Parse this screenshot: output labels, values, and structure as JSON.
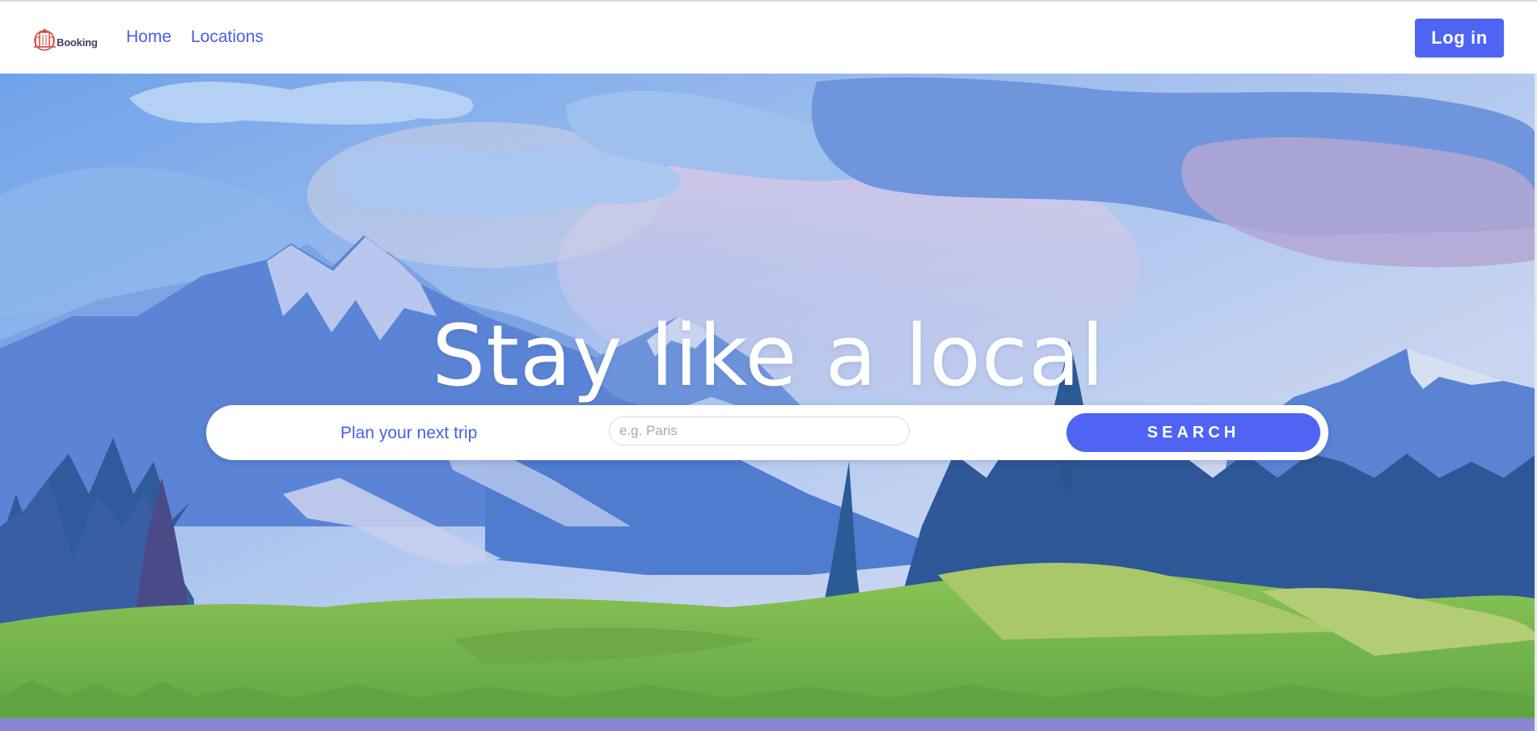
{
  "brand": {
    "logo_text": "Booking"
  },
  "nav": {
    "links": [
      {
        "label": "Home"
      },
      {
        "label": "Locations"
      }
    ]
  },
  "header": {
    "login_label": "Log in"
  },
  "hero": {
    "headline": "Stay like a local",
    "search": {
      "label": "Plan your next trip",
      "placeholder": "e.g. Paris",
      "value": "",
      "button_label": "SEARCH"
    }
  },
  "colors": {
    "accent": "#4f64f2",
    "link": "#4a5fe8",
    "logo_red": "#d9463f",
    "sky_top": "#6f9be6",
    "grass": "#78b84a"
  }
}
